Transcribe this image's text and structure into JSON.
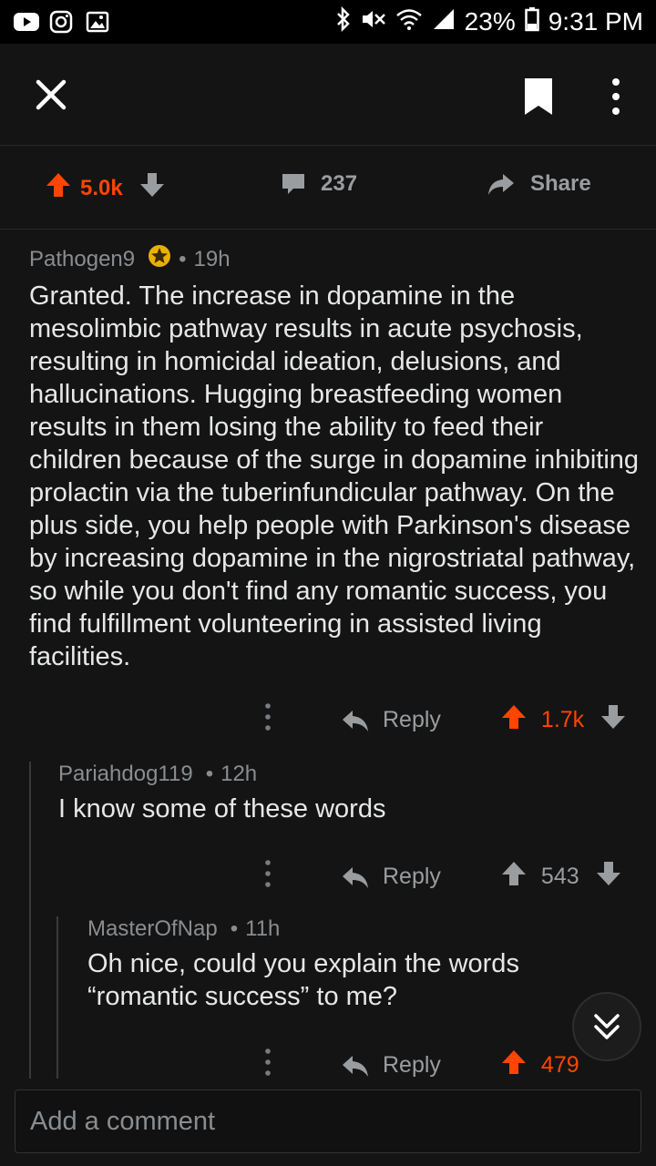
{
  "status_bar": {
    "battery": "23%",
    "time": "9:31 PM",
    "icons": [
      "youtube-icon",
      "instagram-icon",
      "gallery-icon",
      "bluetooth-icon",
      "mute-icon",
      "wifi-icon",
      "signal-icon",
      "battery-icon"
    ]
  },
  "header": {
    "icons": [
      "close-icon",
      "bookmark-icon",
      "more-vertical-icon"
    ]
  },
  "action_bar": {
    "score": "5.0k",
    "comments": "237",
    "share": "Share"
  },
  "comments": [
    {
      "author": "Pathogen9",
      "sep": "•",
      "age": "19h",
      "body": "Granted. The increase in dopamine in the mesolimbic pathway results in acute psychosis, resulting in homicidal ideation, delusions, and hallucinations. Hugging breastfeeding women results in them losing the ability to feed their children because of the surge in dopamine inhibiting prolactin via the tuberinfundicular pathway. On the plus side, you help people with Parkinson's disease by increasing dopamine in the nigrostriatal pathway, so while you don't find any romantic success, you find fulfillment volunteering in assisted living facilities.",
      "reply": "Reply",
      "score": "1.7k"
    },
    {
      "author": "Pariahdog119",
      "sep": "•",
      "age": "12h",
      "body": "I know some of these words",
      "reply": "Reply",
      "score": "543"
    },
    {
      "author": "MasterOfNap",
      "sep": "•",
      "age": "11h",
      "body": "Oh nice, could you explain the words “romantic success” to me?",
      "reply": "Reply",
      "score": "479"
    }
  ],
  "composer": {
    "placeholder": "Add a comment"
  },
  "colors": {
    "background": "#141414",
    "accent_upvote": "#ff4500",
    "award_gold": "#e8b100"
  }
}
